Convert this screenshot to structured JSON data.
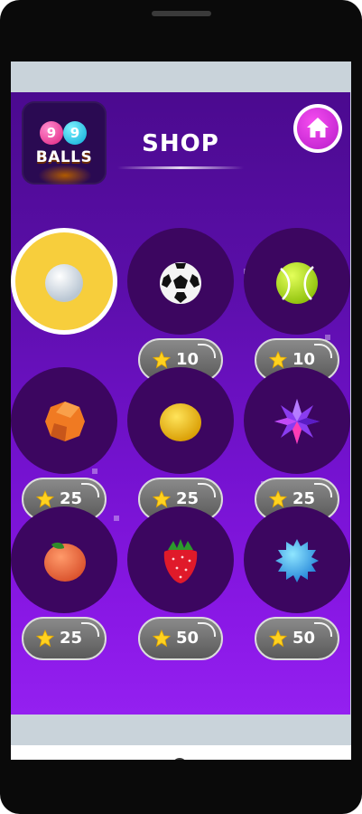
{
  "app": {
    "logo_digits": [
      "9",
      "9"
    ],
    "logo_text": "BALLS",
    "title": "SHOP"
  },
  "colors": {
    "background_top": "#4b0a8f",
    "background_bottom": "#9420f0",
    "slot": "#3c0660",
    "selected_slot": "#f7ce3c",
    "home_button": "#d52ee0",
    "price_pill": "#6e6e6e",
    "star": "#ffd21f"
  },
  "shop": {
    "items": [
      {
        "name": "white ball",
        "selected": true,
        "price": ""
      },
      {
        "name": "soccer ball",
        "selected": false,
        "price": "10"
      },
      {
        "name": "tennis ball",
        "selected": false,
        "price": "10"
      },
      {
        "name": "orange",
        "selected": false,
        "price": "25"
      },
      {
        "name": "lemon",
        "selected": false,
        "price": "25"
      },
      {
        "name": "spiky star",
        "selected": false,
        "price": "25"
      },
      {
        "name": "peach",
        "selected": false,
        "price": "25"
      },
      {
        "name": "strawberry",
        "selected": false,
        "price": "50"
      },
      {
        "name": "spiky blue ball",
        "selected": false,
        "price": "50"
      }
    ]
  },
  "icons": {
    "home": "home-icon",
    "price": "star-icon",
    "nav": [
      "recent-apps-icon",
      "home-nav-icon",
      "back-icon"
    ]
  }
}
